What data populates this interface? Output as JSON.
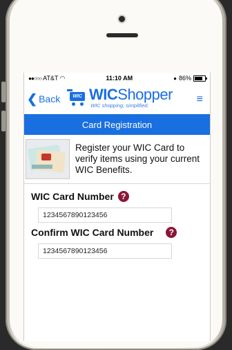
{
  "status": {
    "carrier": "AT&T",
    "time": "11:10 AM",
    "battery": "86%"
  },
  "nav": {
    "back_label": "Back",
    "brand_prefix": "WIC",
    "brand_suffix": "Shopper",
    "tagline": "WIC shopping, simplified.",
    "cart_label": "WIC"
  },
  "page": {
    "title": "Card Registration",
    "intro": "Register your WIC Card to verify items using your current WIC Benefits."
  },
  "form": {
    "card_number_label": "WIC Card Number",
    "card_number_value": "1234567890123456",
    "confirm_label": "Confirm WIC Card Number",
    "confirm_value": "1234567890123456",
    "help_glyph": "?"
  },
  "colors": {
    "accent": "#1a6fe0",
    "help_badge": "#8b1538"
  },
  "icons": [
    "wifi-icon",
    "lock-icon",
    "battery-icon",
    "chevron-left-icon",
    "cart-icon",
    "hamburger-menu-icon",
    "help-icon"
  ]
}
